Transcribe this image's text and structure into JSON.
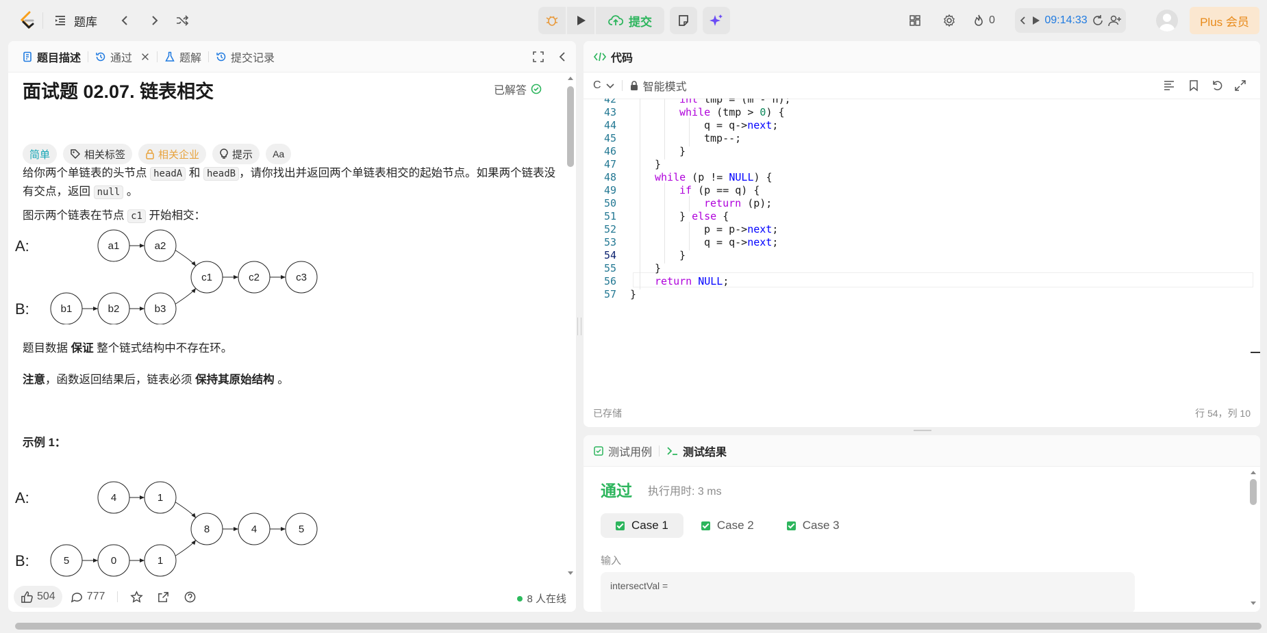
{
  "nav": {
    "problem_list_label": "题库",
    "submit_label": "提交",
    "fire_count": "0",
    "timer": "09:14:33",
    "plus_label": "Plus 会员"
  },
  "left": {
    "tabs": [
      {
        "label": "题目描述"
      },
      {
        "label": "通过"
      },
      {
        "label": "题解"
      },
      {
        "label": "提交记录"
      }
    ],
    "title": "面试题 02.07. 链表相交",
    "solved_label": "已解答",
    "tags": [
      "简单",
      "相关标签",
      "相关企业",
      "提示"
    ],
    "font_tag": "Aa",
    "desc_1a": "给你两个单链表的头节点",
    "code_headA": "headA",
    "desc_1b": "和",
    "code_headB": "headB",
    "desc_1c": "，请你找出并返回两个单链表相交的起始节点。如果两个链表没有交点，返回",
    "code_null": "null",
    "desc_1d": "。",
    "desc_2a": "图示两个链表在节点",
    "code_c1": "c1",
    "desc_2b": "开始相交：",
    "diagram1": {
      "label_a": "A:",
      "label_b": "B:",
      "a_nodes": [
        "a1",
        "a2"
      ],
      "common_nodes": [
        "c1",
        "c2",
        "c3"
      ],
      "b_nodes": [
        "b1",
        "b2",
        "b3"
      ]
    },
    "desc_3a": "题目数据",
    "desc_3b": "保证",
    "desc_3c": "整个链式结构中不存在环。",
    "desc_4a": "注意",
    "desc_4b": "，函数返回结果后，链表必须",
    "desc_4c": "保持其原始结构",
    "desc_4d": "。",
    "example_title": "示例 1：",
    "diagram2": {
      "label_a": "A:",
      "label_b": "B:",
      "a_nodes": [
        "4",
        "1"
      ],
      "common_nodes": [
        "8",
        "4",
        "5"
      ],
      "b_nodes": [
        "5",
        "0",
        "1"
      ]
    },
    "footer": {
      "likes": "504",
      "comments": "777",
      "online": "8 人在线"
    }
  },
  "code": {
    "tab_label": "代码",
    "language": "C",
    "mode": "智能模式",
    "status": "已存储",
    "cursor": "行 54，列 10",
    "lines": [
      {
        "n": "42",
        "indent": 2,
        "text": "int tmp = (m - n);"
      },
      {
        "n": "43",
        "indent": 2,
        "text": "while (tmp > 0) {"
      },
      {
        "n": "44",
        "indent": 3,
        "text": "q = q->next;"
      },
      {
        "n": "45",
        "indent": 3,
        "text": "tmp--;"
      },
      {
        "n": "46",
        "indent": 2,
        "text": "}"
      },
      {
        "n": "47",
        "indent": 1,
        "text": "}"
      },
      {
        "n": "48",
        "indent": 1,
        "text": "while (p != NULL) {"
      },
      {
        "n": "49",
        "indent": 2,
        "text": "if (p == q) {"
      },
      {
        "n": "50",
        "indent": 3,
        "text": "return (p);"
      },
      {
        "n": "51",
        "indent": 2,
        "text": "} else {"
      },
      {
        "n": "52",
        "indent": 3,
        "text": "p = p->next;"
      },
      {
        "n": "53",
        "indent": 3,
        "text": "q = q->next;"
      },
      {
        "n": "54",
        "indent": 2,
        "text": "}"
      },
      {
        "n": "55",
        "indent": 1,
        "text": "}"
      },
      {
        "n": "56",
        "indent": 1,
        "text": "return NULL;"
      },
      {
        "n": "57",
        "indent": 0,
        "text": "}"
      }
    ]
  },
  "result": {
    "tabs": [
      {
        "label": "测试用例"
      },
      {
        "label": "测试结果"
      }
    ],
    "verdict": "通过",
    "runtime": "执行用时: 3 ms",
    "cases": [
      "Case 1",
      "Case 2",
      "Case 3"
    ],
    "input_label": "输入",
    "input_var": "intersectVal ="
  }
}
